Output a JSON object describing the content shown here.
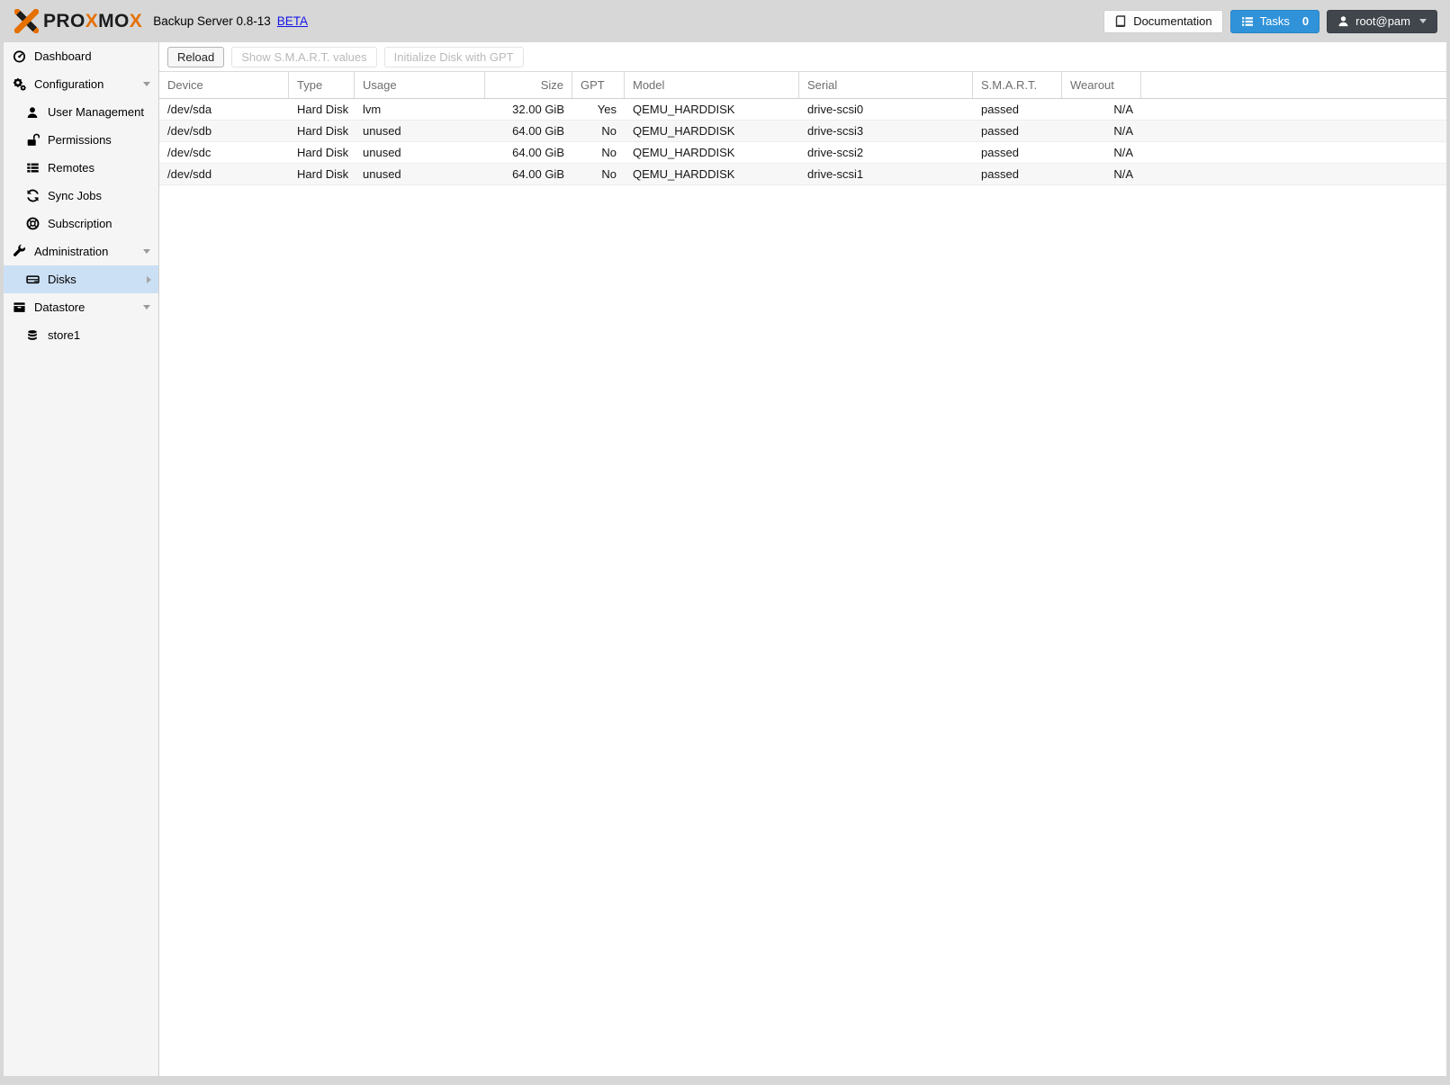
{
  "header": {
    "logo_word_parts": [
      "PRO",
      "X",
      "MO",
      "X"
    ],
    "title": "Backup Server 0.8-13",
    "beta_link": "BETA",
    "documentation_label": "Documentation",
    "tasks_label": "Tasks",
    "tasks_count": "0",
    "user_label": "root@pam"
  },
  "sidebar": {
    "items": [
      {
        "label": "Dashboard",
        "icon": "dashboard-icon",
        "level": 0
      },
      {
        "label": "Configuration",
        "icon": "cogs-icon",
        "level": 0,
        "expandable": true
      },
      {
        "label": "User Management",
        "icon": "user-icon",
        "level": 1
      },
      {
        "label": "Permissions",
        "icon": "unlock-icon",
        "level": 1
      },
      {
        "label": "Remotes",
        "icon": "list-icon",
        "level": 1
      },
      {
        "label": "Sync Jobs",
        "icon": "sync-icon",
        "level": 1
      },
      {
        "label": "Subscription",
        "icon": "life-ring-icon",
        "level": 1
      },
      {
        "label": "Administration",
        "icon": "wrench-icon",
        "level": 0,
        "expandable": true
      },
      {
        "label": "Disks",
        "icon": "hdd-icon",
        "level": 1,
        "selected": true,
        "has_submenu": true
      },
      {
        "label": "Datastore",
        "icon": "archive-icon",
        "level": 0,
        "expandable": true
      },
      {
        "label": "store1",
        "icon": "database-icon",
        "level": 1
      }
    ]
  },
  "toolbar": {
    "buttons": [
      {
        "label": "Reload",
        "enabled": true
      },
      {
        "label": "Show S.M.A.R.T. values",
        "enabled": false
      },
      {
        "label": "Initialize Disk with GPT",
        "enabled": false
      }
    ]
  },
  "disks_table": {
    "columns": [
      "Device",
      "Type",
      "Usage",
      "Size",
      "GPT",
      "Model",
      "Serial",
      "S.M.A.R.T.",
      "Wearout"
    ],
    "rows": [
      [
        "/dev/sda",
        "Hard Disk",
        "lvm",
        "32.00 GiB",
        "Yes",
        "QEMU_HARDDISK",
        "drive-scsi0",
        "passed",
        "N/A"
      ],
      [
        "/dev/sdb",
        "Hard Disk",
        "unused",
        "64.00 GiB",
        "No",
        "QEMU_HARDDISK",
        "drive-scsi3",
        "passed",
        "N/A"
      ],
      [
        "/dev/sdc",
        "Hard Disk",
        "unused",
        "64.00 GiB",
        "No",
        "QEMU_HARDDISK",
        "drive-scsi2",
        "passed",
        "N/A"
      ],
      [
        "/dev/sdd",
        "Hard Disk",
        "unused",
        "64.00 GiB",
        "No",
        "QEMU_HARDDISK",
        "drive-scsi1",
        "passed",
        "N/A"
      ]
    ]
  },
  "colors": {
    "brand_orange": "#e57000",
    "tasks_button_blue": "#3093d9",
    "selected_item_bg": "#cbe0f4",
    "beta_link_blue": "#1414e8",
    "user_button_dark": "#40464c"
  }
}
